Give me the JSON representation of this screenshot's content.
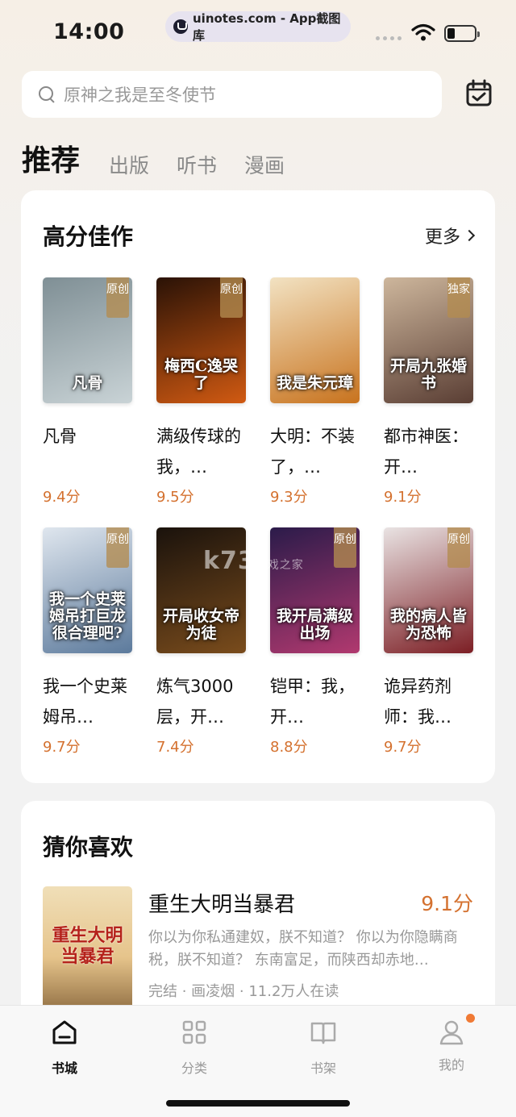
{
  "status_bar": {
    "time": "14:00",
    "url": "uinotes.com - App截图库"
  },
  "search": {
    "placeholder": "原神之我是至冬使节"
  },
  "tabs": [
    {
      "label": "推荐",
      "active": true
    },
    {
      "label": "出版",
      "active": false
    },
    {
      "label": "听书",
      "active": false
    },
    {
      "label": "漫画",
      "active": false
    }
  ],
  "featured": {
    "title": "高分佳作",
    "more_label": "更多",
    "books": [
      {
        "title": "凡骨",
        "score": "9.4分",
        "tag": "原创",
        "cover_text": "凡骨",
        "cover_colors": [
          "#7f8f95",
          "#c9d3d6"
        ]
      },
      {
        "title": "满级传球的我，…",
        "score": "9.5分",
        "tag": "原创",
        "cover_text": "梅西C逸哭了",
        "cover_colors": [
          "#2a1206",
          "#d15a12"
        ]
      },
      {
        "title": "大明：不装了，…",
        "score": "9.3分",
        "tag": "",
        "cover_text": "我是朱元璋",
        "cover_colors": [
          "#f2e2c2",
          "#c8731e"
        ]
      },
      {
        "title": "都市神医：开…",
        "score": "9.1分",
        "tag": "独家",
        "cover_text": "开局九张婚书",
        "cover_colors": [
          "#cdb69c",
          "#5a3e34"
        ]
      },
      {
        "title": "我一个史莱姆吊…",
        "score": "9.7分",
        "tag": "原创",
        "cover_text": "我一个史莱姆吊打巨龙很合理吧?",
        "cover_colors": [
          "#dfe6ee",
          "#5c7a9c"
        ]
      },
      {
        "title": "炼气3000层，开…",
        "score": "7.4分",
        "tag": "",
        "cover_text": "开局收女帝为徒",
        "cover_colors": [
          "#1a120c",
          "#7a4c1c"
        ]
      },
      {
        "title": "铠甲：我，开…",
        "score": "8.8分",
        "tag": "原创",
        "cover_text": "我开局满级出场",
        "cover_colors": [
          "#2b1b4a",
          "#b1396f"
        ]
      },
      {
        "title": "诡异药剂师：我…",
        "score": "9.7分",
        "tag": "原创",
        "cover_text": "我的病人皆为恐怖",
        "cover_colors": [
          "#e9e3e3",
          "#7c1e24"
        ]
      }
    ]
  },
  "guess": {
    "title": "猜你喜欢",
    "book": {
      "title": "重生大明当暴君",
      "score": "9.1分",
      "cover_text": "重生大明当暴君",
      "description": "你以为你私通建奴，朕不知道？ 你以为你隐瞒商税，朕不知道？ 东南富足，而陕西却赤地…",
      "meta": "完结 · 画凌烟 · 11.2万人在读"
    }
  },
  "watermark": {
    "main": "k73",
    "sub": "游戏之家"
  },
  "bottom_nav": [
    {
      "label": "书城",
      "icon": "home-icon",
      "active": true
    },
    {
      "label": "分类",
      "icon": "grid-icon",
      "active": false
    },
    {
      "label": "书架",
      "icon": "book-icon",
      "active": false
    },
    {
      "label": "我的",
      "icon": "user-icon",
      "active": false,
      "badge": true
    }
  ],
  "colors": {
    "accent": "#d4712f",
    "badge": "#f07a35"
  }
}
